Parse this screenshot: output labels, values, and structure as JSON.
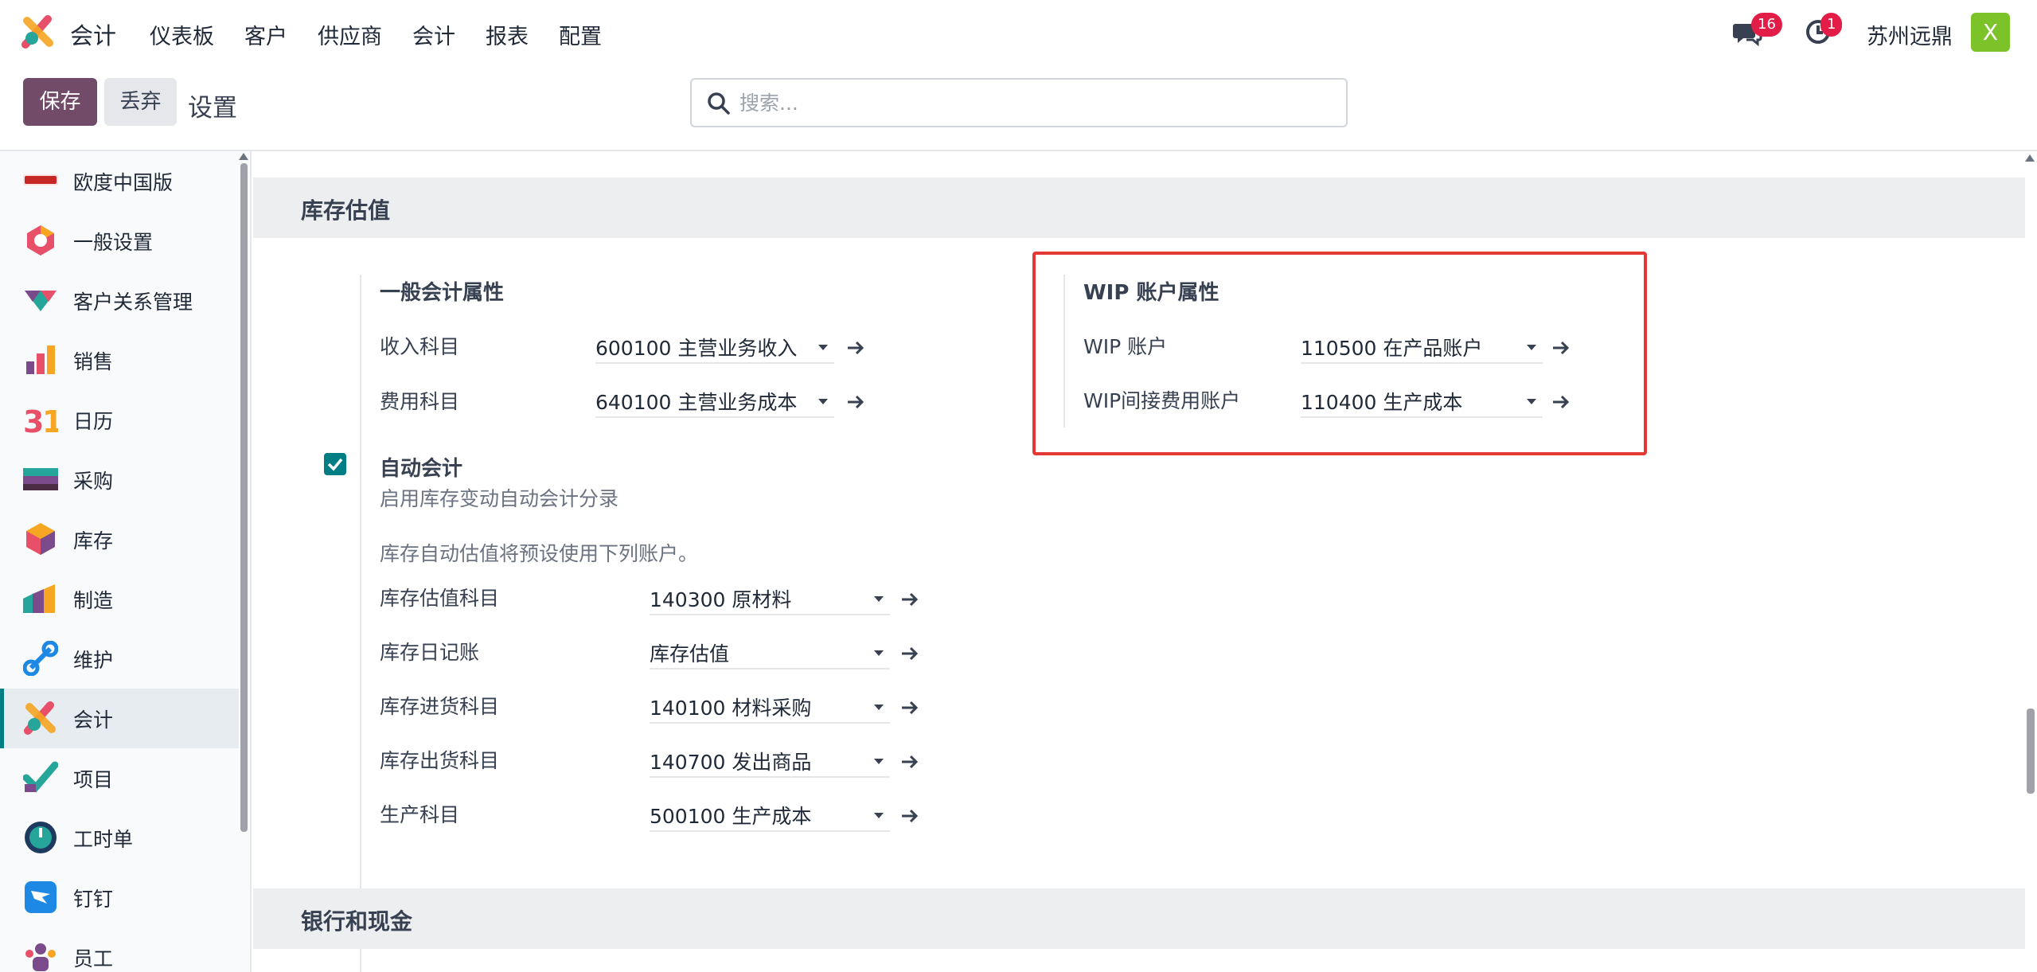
{
  "app": {
    "name": "会计"
  },
  "menu": [
    "仪表板",
    "客户",
    "供应商",
    "会计",
    "报表",
    "配置"
  ],
  "topbar": {
    "messages_count": "16",
    "activities_count": "1",
    "company": "苏州远鼎",
    "avatar_letter": "X"
  },
  "controls": {
    "save_label": "保存",
    "discard_label": "丢弃",
    "page_title": "设置",
    "search_placeholder": "搜索..."
  },
  "sidebar": {
    "items": [
      {
        "label": "欧度中国版",
        "icon": "odoo-china-icon"
      },
      {
        "label": "一般设置",
        "icon": "general-settings-icon"
      },
      {
        "label": "客户关系管理",
        "icon": "crm-icon"
      },
      {
        "label": "销售",
        "icon": "sales-icon"
      },
      {
        "label": "日历",
        "icon": "calendar-icon"
      },
      {
        "label": "采购",
        "icon": "purchase-icon"
      },
      {
        "label": "库存",
        "icon": "inventory-icon"
      },
      {
        "label": "制造",
        "icon": "manufacturing-icon"
      },
      {
        "label": "维护",
        "icon": "maintenance-icon"
      },
      {
        "label": "会计",
        "icon": "accounting-icon",
        "active": true
      },
      {
        "label": "项目",
        "icon": "project-icon"
      },
      {
        "label": "工时单",
        "icon": "timesheet-icon"
      },
      {
        "label": "钉钉",
        "icon": "dingtalk-icon"
      },
      {
        "label": "员工",
        "icon": "employees-icon"
      }
    ]
  },
  "inventory_valuation": {
    "title": "库存估值",
    "general": {
      "title": "一般会计属性",
      "rows": [
        {
          "label": "收入科目",
          "value": "600100 主营业务收入"
        },
        {
          "label": "费用科目",
          "value": "640100 主营业务成本"
        }
      ]
    },
    "wip": {
      "title": "WIP 账户属性",
      "rows": [
        {
          "label": "WIP 账户",
          "value": "110500 在产品账户"
        },
        {
          "label": "WIP间接费用账户",
          "value": "110400 生产成本"
        }
      ]
    },
    "auto": {
      "title": "自动会计",
      "checked": true,
      "desc": "启用库存变动自动会计分录",
      "note": "库存自动估值将预设使用下列账户。",
      "rows": [
        {
          "label": "库存估值科目",
          "value": "140300 原材料"
        },
        {
          "label": "库存日记账",
          "value": "库存估值"
        },
        {
          "label": "库存进货科目",
          "value": "140100 材料采购"
        },
        {
          "label": "库存出货科目",
          "value": "140700 发出商品"
        },
        {
          "label": "生产科目",
          "value": "500100 生产成本"
        }
      ]
    }
  },
  "bank_cash": {
    "title": "银行和现金"
  },
  "colors": {
    "brand": "#714b67",
    "accent": "#017e84",
    "highlight": "#e53935",
    "badge": "#e11d48"
  }
}
